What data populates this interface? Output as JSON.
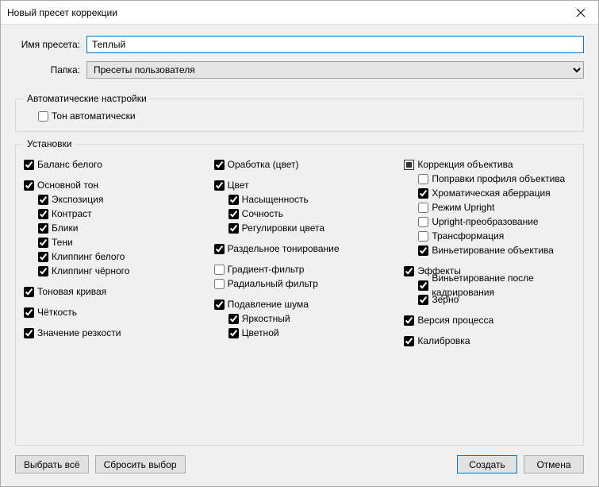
{
  "window": {
    "title": "Новый пресет коррекции"
  },
  "form": {
    "preset_name_label": "Имя пресета:",
    "preset_name_value": "Теплый",
    "folder_label": "Папка:",
    "folder_value": "Пресеты пользователя"
  },
  "auto": {
    "legend": "Автоматические настройки",
    "auto_tone": "Тон автоматически"
  },
  "settings": {
    "legend": "Установки",
    "col1": {
      "white_balance": "Баланс белого",
      "basic_tone": "Основной тон",
      "exposure": "Экспозиция",
      "contrast": "Контраст",
      "highlights": "Блики",
      "shadows": "Тени",
      "white_clip": "Клиппинг белого",
      "black_clip": "Клиппинг чёрного",
      "tone_curve": "Тоновая кривая",
      "clarity": "Чёткость",
      "sharpening": "Значение резкости"
    },
    "col2": {
      "treatment": "Оработка (цвет)",
      "color": "Цвет",
      "saturation": "Насыщенность",
      "vibrance": "Сочность",
      "color_adjust": "Регулировки цвета",
      "split_tone": "Раздельное тонирование",
      "grad_filter": "Градиент-фильтр",
      "radial_filter": "Радиальный фильтр",
      "noise": "Подавление шума",
      "luminance": "Яркостный",
      "chroma_noise": "Цветной"
    },
    "col3": {
      "lens_corr": "Коррекция объектива",
      "lens_profile": "Поправки профиля объектива",
      "chromatic": "Хроматическая аберрация",
      "upright_mode": "Режим Upright",
      "upright_transform": "Upright-преобразование",
      "transform": "Трансформация",
      "lens_vignette": "Виньетирование объектива",
      "effects": "Эффекты",
      "postcrop_vig": "Виньетирование после кадрирования",
      "grain": "Зерно",
      "process_ver": "Версия процесса",
      "calibration": "Калибровка"
    }
  },
  "buttons": {
    "select_all": "Выбрать всё",
    "clear": "Сбросить выбор",
    "create": "Создать",
    "cancel": "Отмена"
  }
}
